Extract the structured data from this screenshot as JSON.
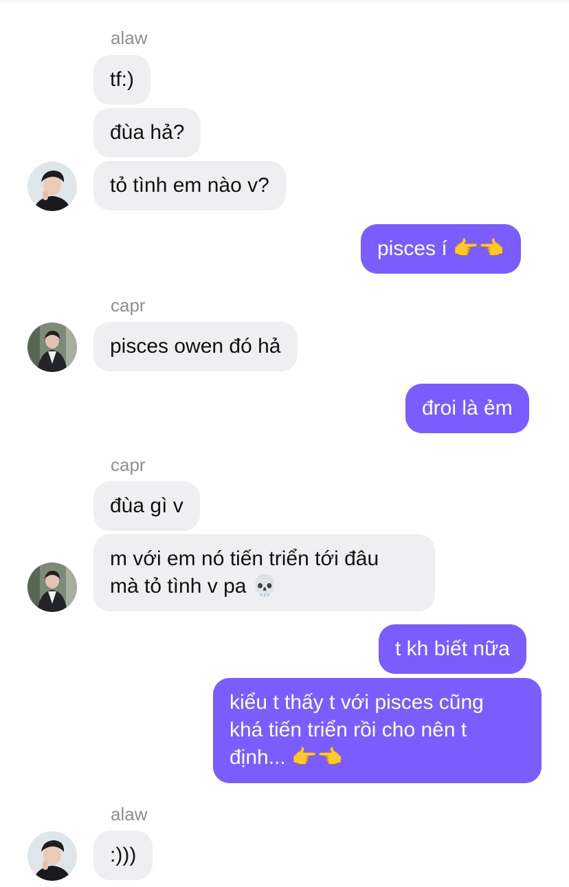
{
  "messages": [
    {
      "type": "sender",
      "text": "alaw"
    },
    {
      "type": "in",
      "text": "tf:)"
    },
    {
      "type": "in",
      "text": "đùa hả?"
    },
    {
      "type": "in",
      "text": "tỏ tình em nào v?"
    },
    {
      "type": "out",
      "text": "pisces í 👉👈"
    },
    {
      "type": "sender",
      "text": "capr"
    },
    {
      "type": "in",
      "text": "pisces owen đó hả"
    },
    {
      "type": "out",
      "text": "đroi là ẻm"
    },
    {
      "type": "sender",
      "text": "capr"
    },
    {
      "type": "in",
      "text": "đùa gì v"
    },
    {
      "type": "in",
      "text": "m với em nó tiến triển tới đâu\nmà tỏ tình v pa 💀"
    },
    {
      "type": "out",
      "text": "t kh biết nữa"
    },
    {
      "type": "out",
      "text": "kiểu t thấy t với pisces cũng\nkhá tiến triển rồi cho nên t\nđịnh... 👉👈"
    },
    {
      "type": "sender",
      "text": "alaw"
    },
    {
      "type": "in",
      "text": ":)))"
    }
  ],
  "avatars": {
    "alaw": "alaw-avatar",
    "capr": "capr-avatar"
  },
  "colors": {
    "incoming_bubble": "#efeff1",
    "outgoing_bubble": "#7b5cff",
    "sender_name": "#8e8e93"
  }
}
